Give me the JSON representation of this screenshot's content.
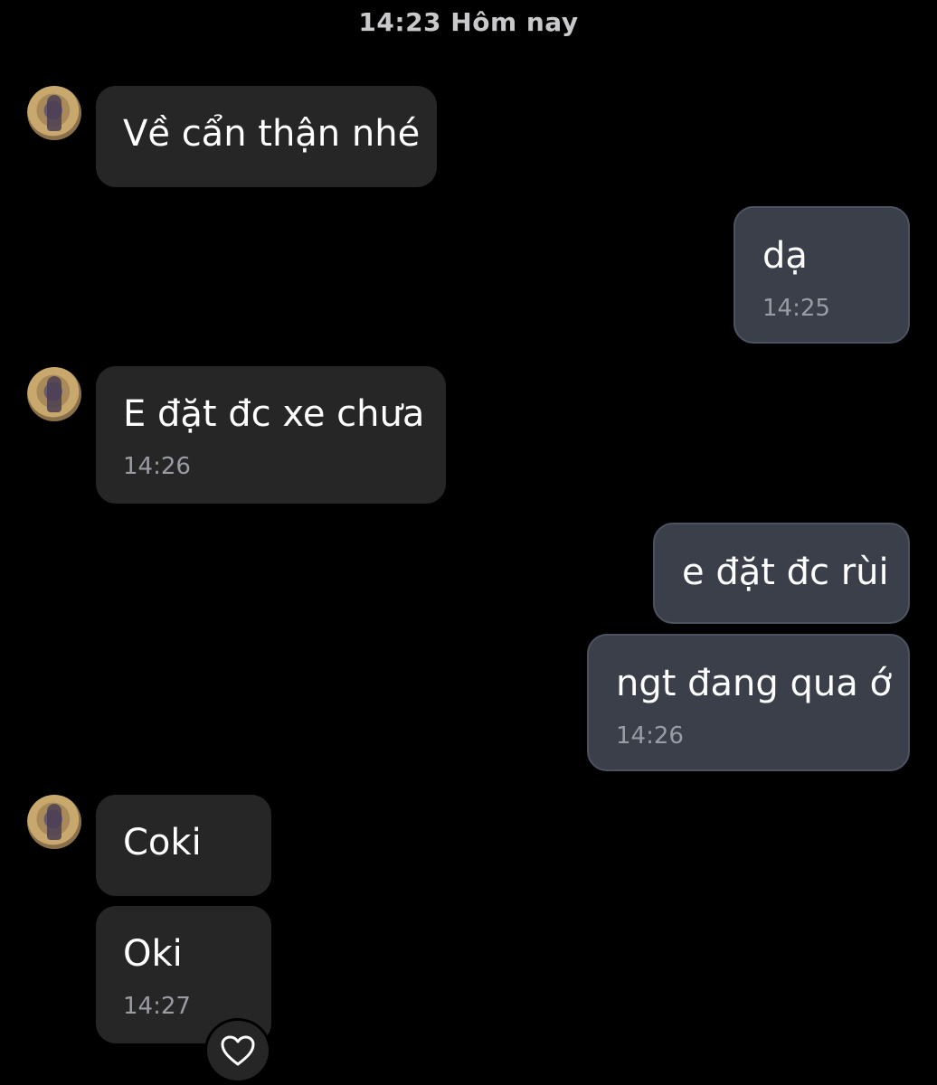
{
  "header": {
    "timestamp": "14:23 Hôm nay"
  },
  "messages": [
    {
      "text": "Về cẩn thận nhé"
    },
    {
      "text": "dạ",
      "time": "14:25"
    },
    {
      "text": "E đặt đc xe chưa",
      "time": "14:26"
    },
    {
      "text": "e đặt đc rùi"
    },
    {
      "text": "ngt đang qua ớ",
      "time": "14:26"
    },
    {
      "text": "Coki"
    },
    {
      "text": "Oki",
      "time": "14:27",
      "reaction": "heart-icon"
    }
  ],
  "colors": {
    "background": "#000000",
    "incoming_bubble": "#262626",
    "outgoing_bubble": "#3a3f4a",
    "timestamp_text": "#9a9ca3"
  }
}
